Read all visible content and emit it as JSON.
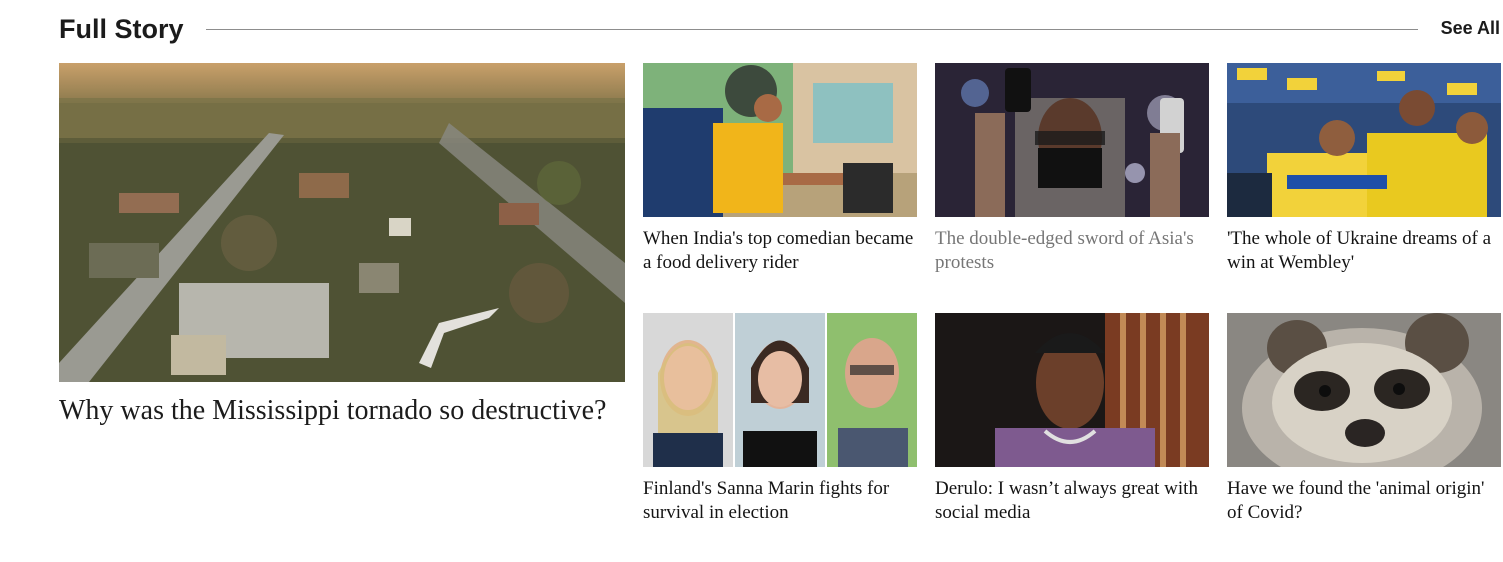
{
  "section": {
    "title": "Full Story",
    "see_all": "See All"
  },
  "lead_story": {
    "headline": "Why was the Mississippi tornado so destructive?",
    "image": "aerial-tornado-damage-image"
  },
  "stories": [
    {
      "headline": "When India's top comedian became a food delivery rider",
      "image": "food-delivery-rider-image",
      "visited": false
    },
    {
      "headline": "The double-edged sword of Asia's protests",
      "image": "protest-phones-image",
      "visited": true
    },
    {
      "headline": "'The whole of Ukraine dreams of a win at Wembley'",
      "image": "ukraine-football-fans-image",
      "visited": false
    },
    {
      "headline": "Finland's Sanna Marin fights for survival in election",
      "image": "finnish-politicians-image",
      "visited": false
    },
    {
      "headline": "Derulo: I wasn’t always great with social media",
      "image": "jason-derulo-image",
      "visited": false
    },
    {
      "headline": "Have we found the 'animal origin' of Covid?",
      "image": "raccoon-dog-image",
      "visited": false
    }
  ],
  "colors": {
    "text": "#141414",
    "visited_text": "#767676",
    "rule": "#8d8d8d"
  }
}
